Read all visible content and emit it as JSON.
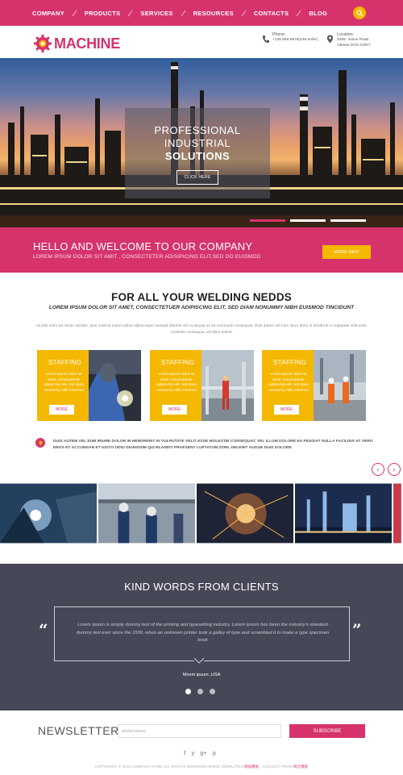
{
  "nav": {
    "items": [
      "COMPANY",
      "PRODUCTS",
      "SERVICES",
      "RESOURCES",
      "CONTACTS",
      "BLOG"
    ],
    "search_icon": "search-icon"
  },
  "header": {
    "logo_text": "MACHINE",
    "phone_label": "Phone:",
    "phone_value": "+128 658-5976(248-order)",
    "location_label": "Location:",
    "location_line1": "2455- minus Road",
    "location_line2": "Ottawa DGS GSRT"
  },
  "hero": {
    "line1": "PROFESSIONAL",
    "line2": "INDUSTRIAL",
    "line3": "SOLUTIONS",
    "button": "CLICK HERE",
    "active_slide": 1,
    "slide_count": 3
  },
  "band": {
    "title": "HELLO AND WELCOME TO OUR COMPANY",
    "subtitle": "LOREM IPSUM DOLOR SIT AMIT , CONSECTETER ADISIPICING ELIT,SED DO EUISMOD",
    "button": "MORE INFO"
  },
  "welding": {
    "title": "FOR ALL YOUR WELDING NEDDS",
    "subtitle": "LOREM IPSUM DOLOR SIT AMET, CONSECTETUER ADIPISCING ELIT, SED DIAM NONUMMY NIBH EUISMOD TINCIDUNT",
    "text": "Ut wisi enim ad minim veniam, quis nostrud exerci tation ullamcorper suscipit lobortis nisl ut aliquip ex ea commodo consequat. Duis autem vel eum iriure dolor in hendrerit in vulputate velit esse molestie consequat, vel illum dolore"
  },
  "cards": [
    {
      "title": "STAFFING",
      "text": "Lorem ipsum dolor sit amet, consectetuer adipiscing elit, sed diam nonummy nibh euismod",
      "button": "MORE"
    },
    {
      "title": "STAFFING",
      "text": "Lorem ipsum dolor sit amet, consectetuer adipiscing elit, sed diam nonummy nibh euismod",
      "button": "MORE"
    },
    {
      "title": "STAFFING",
      "text": "Lorem ipsum dolor sit amet, consectetuer adipiscing elit, sed diam nonummy nibh euismod",
      "button": "MORE"
    }
  ],
  "info": {
    "text": "DUIS AUTEM VEL EUM IRIURE DOLOR IN HENDRERIT IN VULPUTATE VELIT ESSE MOLESTIE CONSEQUAT, VEL ILLUM DOLORE EU FEUGIAT NULLA FACILISIS AT VERO EROS ET ACCUMSAN ET IUSTO ODIO DIGNISSIM QUI BLANDIT PRAESENT LUPTATUM ZZRIL DELENIT AUGUE DUIS DOLORE",
    "prev": "‹",
    "next": "›"
  },
  "testimonial": {
    "title": "KIND WORDS FROM CLIENTS",
    "text": "Lorem Ipsum is simply dummy text of the printing and typesetting industry. Lorem Ipsum has been the industry's standard dummy text ever since the 1500, when an unknown printer took a galley of type and scrambled it to make a type specimen book",
    "name": "Mirem ipsum ,USA",
    "quote_open": "“",
    "quote_close": "”",
    "active_dot": 0,
    "dot_count": 3
  },
  "newsletter": {
    "title": "NEWSLETTER",
    "placeholder": "ENTER EMAIL",
    "button": "SUBSCRIBE"
  },
  "social": [
    "f",
    "y",
    "g+",
    "p"
  ],
  "footer": {
    "text": "COPYRIGHT © 2015 COMPANY NAME ALL RIGHTS RESERVED.MORE TEMPLATES",
    "link1": "网站模板",
    "mid": "- COLLECT FROM",
    "link2": "网页模板"
  },
  "colors": {
    "accent": "#d6336c",
    "yellow": "#f5b800",
    "dark": "#464857"
  }
}
